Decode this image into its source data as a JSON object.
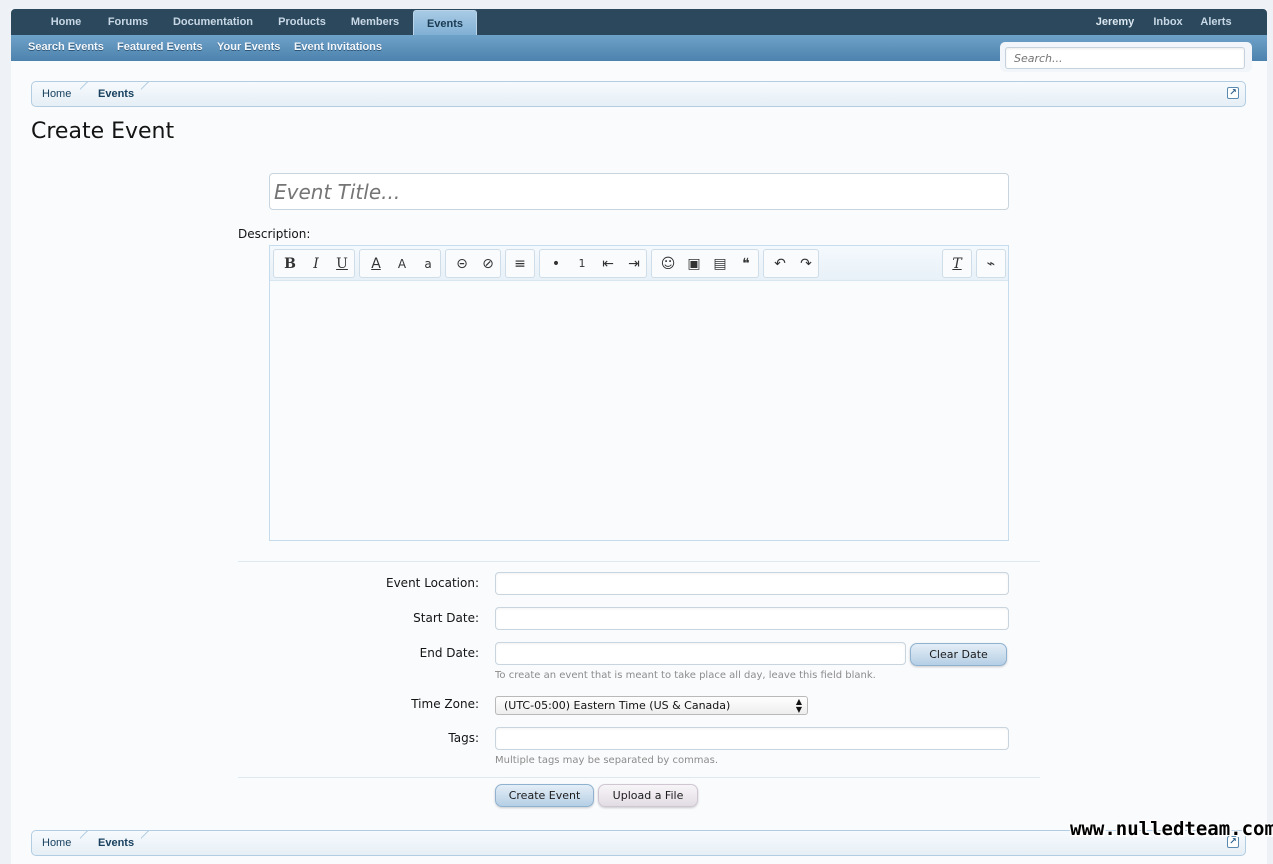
{
  "nav": {
    "tabs": [
      "Home",
      "Forums",
      "Documentation",
      "Products",
      "Members",
      "Events"
    ],
    "user_links": [
      "Jeremy",
      "Inbox",
      "Alerts"
    ]
  },
  "subnav": {
    "items": [
      "Search Events",
      "Featured Events",
      "Your Events",
      "Event Invitations"
    ]
  },
  "search": {
    "placeholder": "Search..."
  },
  "breadcrumb": {
    "home": "Home",
    "current": "Events"
  },
  "page": {
    "title": "Create Event"
  },
  "form": {
    "title_placeholder": "Event Title...",
    "description_label": "Description:",
    "location_label": "Event Location:",
    "start_label": "Start Date:",
    "end_label": "End Date:",
    "clear_date": "Clear Date",
    "end_hint": "To create an event that is meant to take place all day, leave this field blank.",
    "timezone_label": "Time Zone:",
    "timezone_value": "(UTC-05:00) Eastern Time (US & Canada)",
    "tags_label": "Tags:",
    "tags_hint": "Multiple tags may be separated by commas.",
    "submit": "Create Event",
    "upload": "Upload a File"
  },
  "toolbar": {
    "bold": "B",
    "italic": "I",
    "underline": "U",
    "color": "A",
    "size": "A",
    "font": "a",
    "link": "⊝",
    "unlink": "⊘",
    "align": "≡",
    "ul": "•",
    "ol": "1",
    "outdent": "⇤",
    "indent": "⇥",
    "smiley": "☺",
    "image": "▣",
    "media": "▤",
    "quote": "❝",
    "undo": "↶",
    "redo": "↷",
    "remove_format": "T",
    "source": "⌁"
  },
  "watermark": "www.nulledteam.com",
  "colors": {
    "nav_bg": "#2b485c",
    "subnav_bg": "#5a90ba",
    "accent": "#19415f"
  }
}
